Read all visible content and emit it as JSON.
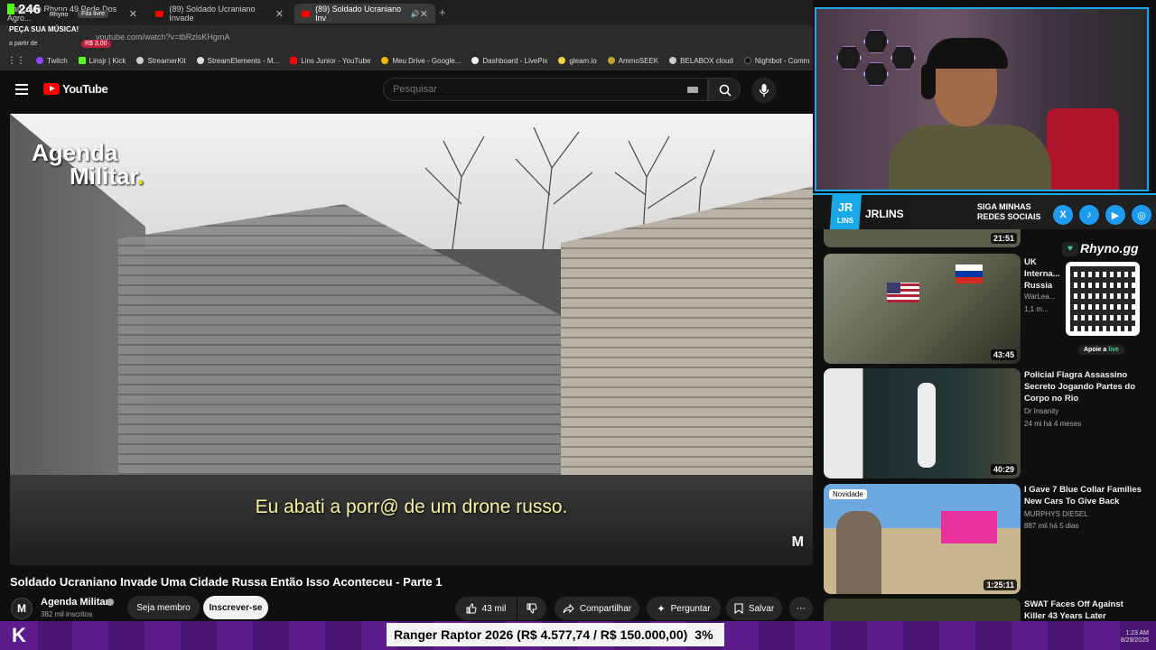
{
  "browser": {
    "tabs": [
      {
        "label": "Banco de Rhyno 49 Pede Dos Agro..."
      },
      {
        "label": "(89) Soldado Ucraniano Invade"
      },
      {
        "label": "(89) Soldado Ucraniano Inv"
      }
    ],
    "url": "youtube.com/watch?v=tbRzlsKHgmA",
    "bookmarks": [
      "Twitch",
      "Linsjr | Kick",
      "StreamerKit",
      "StreamElements - M...",
      "Lins Junior - YouTube",
      "Meu Drive - Google...",
      "Dashboard - LivePix",
      "gleam.io",
      "AmmoSEEK",
      "BELABOX cloud",
      "Nightbot - Comm"
    ]
  },
  "overlay": {
    "count": "246",
    "name": "Rhyno",
    "queue_label": "Fila livre",
    "request_label": "PEÇA SUA MÚSICA!",
    "from_label": "a partir de",
    "price": "R$ 3,00"
  },
  "youtube": {
    "logo_text": "YouTube",
    "search_placeholder": "Pesquisar"
  },
  "video": {
    "channel_watermark_line1": "Agenda",
    "channel_watermark_line2": "Militar",
    "watermark_dot": ".",
    "subtitle": "Eu abati a porr@ de um drone russo.",
    "corner_mark": "M",
    "title": "Soldado Ucraniano Invade Uma Cidade Russa Então Isso Aconteceu - Parte 1"
  },
  "channel": {
    "avatar_letter": "M",
    "name": "Agenda Militar",
    "subscribers": "382 mil inscritos",
    "member_label": "Seja membro",
    "subscribe_label": "Inscrever-se"
  },
  "actions": {
    "likes": "43 mil",
    "share_label": "Compartilhar",
    "ask_label": "Perguntar",
    "save_label": "Salvar"
  },
  "social": {
    "badge": "JR",
    "badge2": "LINS",
    "name": "JRLINS",
    "cta_line1": "SIGA MINHAS",
    "cta_line2": "REDES SOCIAIS",
    "icons": [
      "X",
      "♪",
      "▶",
      "◎"
    ]
  },
  "rhyno": {
    "title": "Rhyno.gg",
    "support_label": "Apoie a",
    "live_label": "live"
  },
  "recommendations": [
    {
      "duration": "21:51",
      "title": "",
      "channel": "",
      "meta": ""
    },
    {
      "duration": "43:45",
      "title": "UK Interna... Russia",
      "channel": "WarLea...",
      "meta": "1,1 m..."
    },
    {
      "duration": "40:29",
      "title": "Policial Flagra Assassino Secreto Jogando Partes do Corpo no Rio",
      "channel": "Dr Insanity",
      "meta": "24 mi  há 4 meses"
    },
    {
      "duration": "1:25:11",
      "badge": "Novidade",
      "title": "I Gave 7 Blue Collar Families New Cars To Give Back",
      "channel": "MURPHYS DIESEL",
      "meta": "887 mil  há 5 dias"
    },
    {
      "duration": "",
      "title": "SWAT Faces Off Against Killer 43 Years Later",
      "channel": "",
      "meta": ""
    }
  ],
  "ticker": {
    "logo": "K",
    "goal_text": "Ranger Raptor 2026 (R$ 4.577,74 / R$ 150.000,00)",
    "goal_percent": "3%",
    "tray_lang": "ENG",
    "tray_time": "1:23 AM",
    "tray_date": "8/29/2025"
  },
  "colors": {
    "accent": "#19a8e8",
    "youtube_red": "#ff0000",
    "ticker_purple": "#5d1c8c"
  }
}
